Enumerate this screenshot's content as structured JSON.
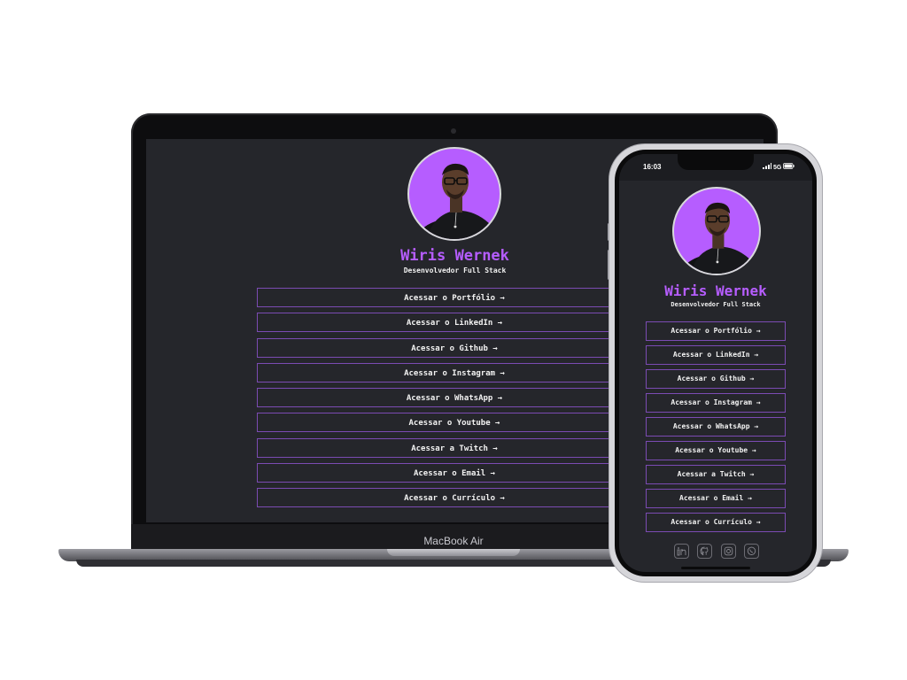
{
  "profile": {
    "name": "Wiris Wernek",
    "title": "Desenvolvedor Full Stack"
  },
  "links": [
    {
      "label": "Acessar o Portfólio →"
    },
    {
      "label": "Acessar o LinkedIn →"
    },
    {
      "label": "Acessar o Github →"
    },
    {
      "label": "Acessar o Instagram →"
    },
    {
      "label": "Acessar o WhatsApp →"
    },
    {
      "label": "Acessar o Youtube →"
    },
    {
      "label": "Acessar a Twitch →"
    },
    {
      "label": "Acessar o Email →"
    },
    {
      "label": "Acessar o Currículo →"
    }
  ],
  "device": {
    "laptop_brand": "MacBook Air",
    "phone_time": "16:03",
    "phone_network": "5G"
  },
  "social_icons": [
    "linkedin-icon",
    "github-icon",
    "instagram-icon",
    "whatsapp-icon"
  ],
  "colors": {
    "accent": "#b65dff",
    "background": "#25262b",
    "border": "#7b4bb3",
    "text": "#f2f2f2"
  }
}
